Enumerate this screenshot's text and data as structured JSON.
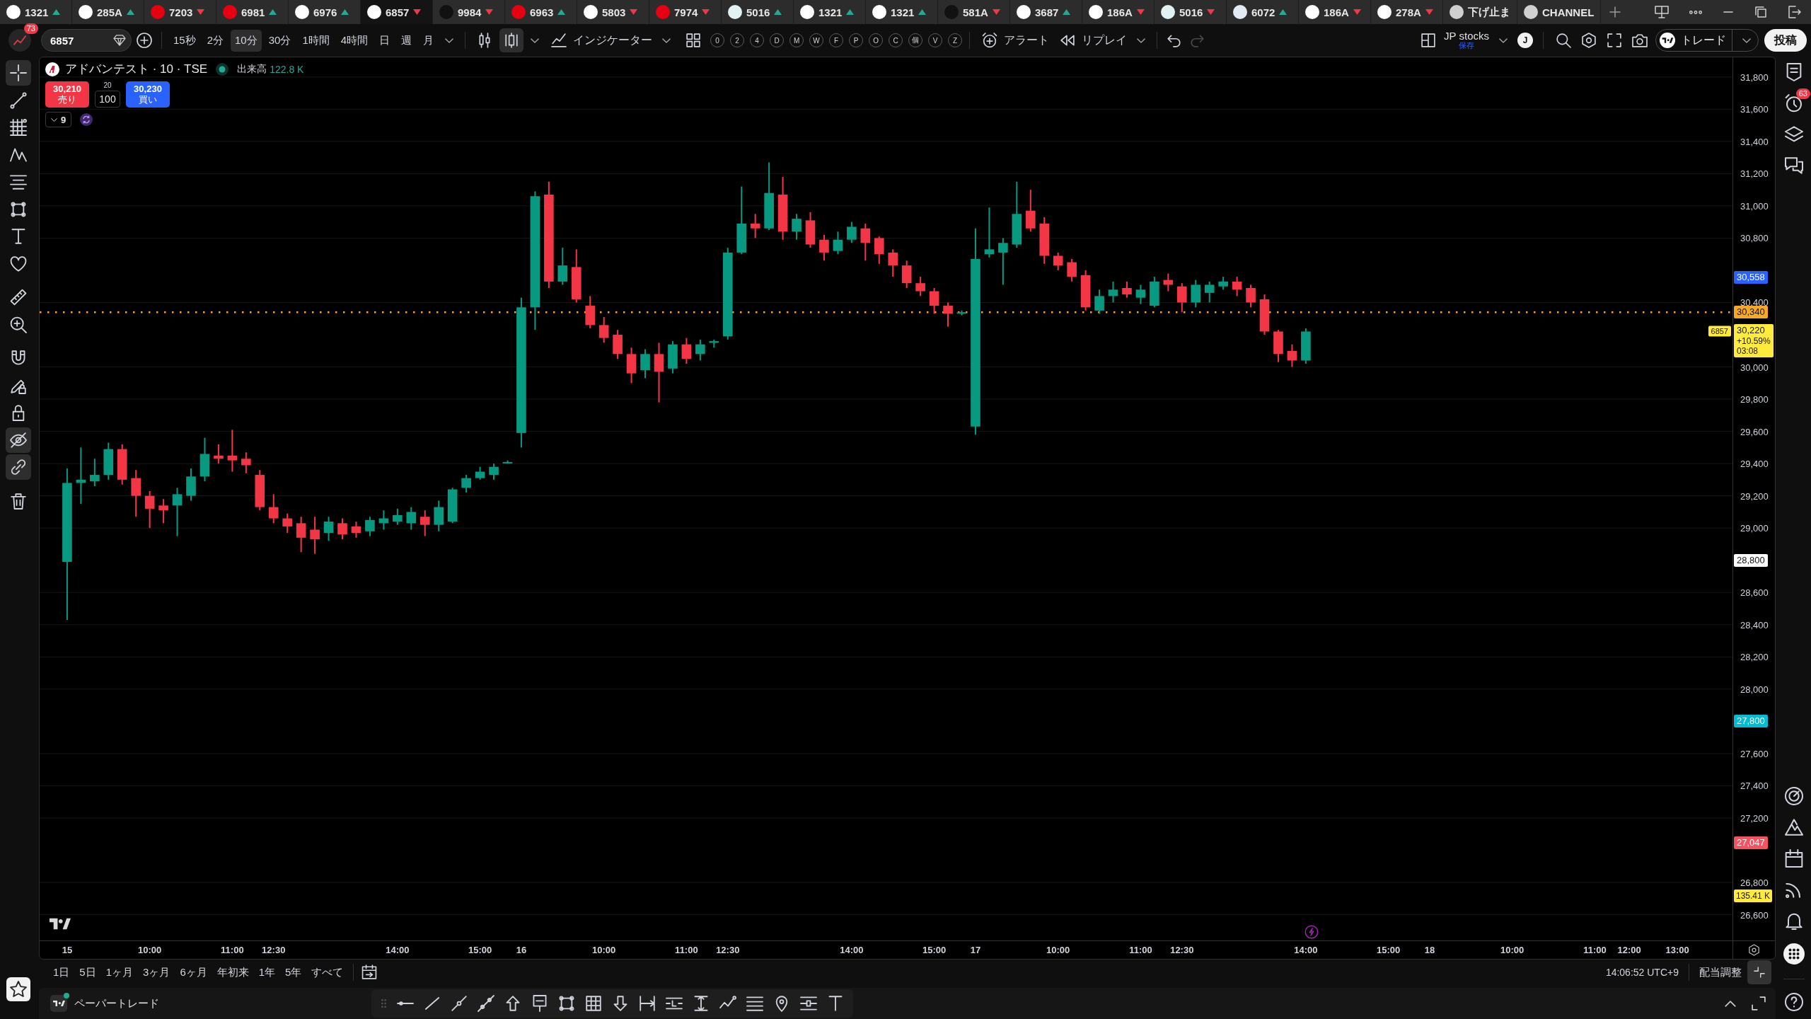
{
  "tabs": [
    {
      "symbol": "1321",
      "rising": true,
      "selected": false,
      "color": "#ffffff"
    },
    {
      "symbol": "285A",
      "rising": true,
      "selected": false,
      "color": "#ffffff"
    },
    {
      "symbol": "7203",
      "rising": false,
      "selected": false,
      "color": "#e60012"
    },
    {
      "symbol": "6981",
      "rising": true,
      "selected": false,
      "color": "#e60012"
    },
    {
      "symbol": "6976",
      "rising": true,
      "selected": false,
      "color": "#ffffff"
    },
    {
      "symbol": "6857",
      "rising": false,
      "selected": true,
      "color": "#ffffff"
    },
    {
      "symbol": "9984",
      "rising": false,
      "selected": false,
      "color": "#111111"
    },
    {
      "symbol": "6963",
      "rising": true,
      "selected": false,
      "color": "#e60012"
    },
    {
      "symbol": "5803",
      "rising": false,
      "selected": false,
      "color": "#ffffff"
    },
    {
      "symbol": "7974",
      "rising": false,
      "selected": false,
      "color": "#e60012"
    },
    {
      "symbol": "5016",
      "rising": true,
      "selected": false,
      "color": "#e0f2f1"
    },
    {
      "symbol": "1321",
      "rising": true,
      "selected": false,
      "color": "#ffffff"
    },
    {
      "symbol": "1321",
      "rising": true,
      "selected": false,
      "color": "#ffffff"
    },
    {
      "symbol": "581A",
      "rising": false,
      "selected": false,
      "color": "#111111"
    },
    {
      "symbol": "3687",
      "rising": true,
      "selected": false,
      "color": "#ffffff"
    },
    {
      "symbol": "186A",
      "rising": false,
      "selected": false,
      "color": "#ffffff"
    },
    {
      "symbol": "5016",
      "rising": false,
      "selected": false,
      "color": "#e0f2f1"
    },
    {
      "symbol": "6072",
      "rising": true,
      "selected": false,
      "color": "#e3eaf6"
    },
    {
      "symbol": "186A",
      "rising": false,
      "selected": false,
      "color": "#ffffff"
    },
    {
      "symbol": "278A",
      "rising": false,
      "selected": false,
      "color": "#ffffff"
    },
    {
      "symbol": "下げ止ま",
      "selected": false,
      "color": "#d0d0d0"
    },
    {
      "symbol": "CHANNEL",
      "selected": false,
      "color": "#d0d0d0"
    }
  ],
  "toolbar": {
    "notifications": "73",
    "symbol": "6857",
    "intervals": [
      {
        "label": "15秒",
        "selected": false
      },
      {
        "label": "2分",
        "selected": false
      },
      {
        "label": "10分",
        "selected": true
      },
      {
        "label": "30分",
        "selected": false
      },
      {
        "label": "1時間",
        "selected": false
      },
      {
        "label": "4時間",
        "selected": false
      },
      {
        "label": "日",
        "selected": false
      },
      {
        "label": "週",
        "selected": false
      },
      {
        "label": "月",
        "selected": false
      }
    ],
    "chart_styles": [
      {
        "selected": false
      },
      {
        "selected": true
      }
    ],
    "indicators": "インジケーター",
    "quick_buttons": [
      "0",
      "2",
      "4",
      "D",
      "M",
      "W",
      "F",
      "P",
      "O",
      "C",
      "個",
      "V",
      "Z"
    ],
    "alert": "アラート",
    "replay": "リプレイ",
    "undo": {
      "disabled": false
    },
    "redo": {
      "disabled": true
    },
    "layout_name": "JP stocks",
    "layout_status": "保存",
    "user_initial": "J",
    "trade": "トレード",
    "publish": "投稿"
  },
  "left_toolbar": {
    "tools": [
      {
        "selected": true
      },
      {
        "selected": false
      },
      {
        "selected": false
      },
      {
        "selected": false
      },
      {
        "selected": false
      },
      {
        "selected": false
      },
      {
        "selected": false
      },
      {
        "selected": false
      },
      {
        "selected": false
      },
      {
        "selected": false
      }
    ],
    "toggles": [
      {
        "on": false
      },
      {
        "on": false
      },
      {
        "on": false
      },
      {
        "on": true
      },
      {
        "on": true
      }
    ]
  },
  "right_toolbar": {
    "alerts_badge": "63"
  },
  "chart": {
    "title": "アドバンテスト · 10 · TSE",
    "market_open": true,
    "volume_label": "出来高",
    "volume": "122.8 K",
    "sell": {
      "price": "30,210",
      "label": "売り"
    },
    "spread": "20",
    "quantity": "100",
    "buy": {
      "price": "30,230",
      "label": "買い"
    },
    "indicators": {
      "count": "9",
      "expanded": false
    },
    "price_axis": {
      "labels": [
        "31,800",
        "31,600",
        "31,400",
        "31,200",
        "31,000",
        "30,800",
        "30,400",
        "30,000",
        "29,800",
        "29,600",
        "29,400",
        "29,200",
        "29,000",
        "28,600",
        "28,400",
        "28,200",
        "28,000",
        "27,600",
        "27,400",
        "27,200",
        "26,800",
        "26,600"
      ],
      "badges": [
        {
          "kind": "plain",
          "label": "30,558",
          "color": "#2962ff"
        },
        {
          "kind": "line",
          "label": "30,340",
          "color": "#f9a825"
        },
        {
          "kind": "last",
          "label": "30,220",
          "change": "+10.59%",
          "countdown": "03:08",
          "tag": "6857",
          "color": "#ffeb3b"
        },
        {
          "kind": "plain",
          "label": "28,800",
          "color": "#ffffff"
        },
        {
          "kind": "plain",
          "label": "27,800",
          "color": "#00bcd4"
        },
        {
          "kind": "plain",
          "label": "27,047",
          "color": "#f7525f"
        },
        {
          "kind": "volume",
          "label": "135.41 K",
          "color": "#ffeb3b"
        }
      ]
    },
    "time_axis": {
      "labels": [
        "15",
        "10:00",
        "11:00",
        "12:30",
        "14:00",
        "15:00",
        "16",
        "10:00",
        "11:00",
        "12:30",
        "14:00",
        "15:00",
        "17",
        "10:00",
        "11:00",
        "12:30",
        "14:00",
        "15:00",
        "18",
        "10:00",
        "11:00",
        "12:00",
        "13:00"
      ]
    }
  },
  "range_bar": {
    "ranges": [
      {
        "label": "1日",
        "selected": false
      },
      {
        "label": "5日",
        "selected": false
      },
      {
        "label": "1ヶ月",
        "selected": false
      },
      {
        "label": "3ヶ月",
        "selected": false
      },
      {
        "label": "6ヶ月",
        "selected": false
      },
      {
        "label": "年初来",
        "selected": false
      },
      {
        "label": "1年",
        "selected": false
      },
      {
        "label": "5年",
        "selected": false
      },
      {
        "label": "すべて",
        "selected": false
      }
    ],
    "clock": "14:06:52 UTC+9",
    "adjustment": "配当調整"
  },
  "bottom_panel": {
    "label": "ペーパートレード",
    "connected": true
  }
}
